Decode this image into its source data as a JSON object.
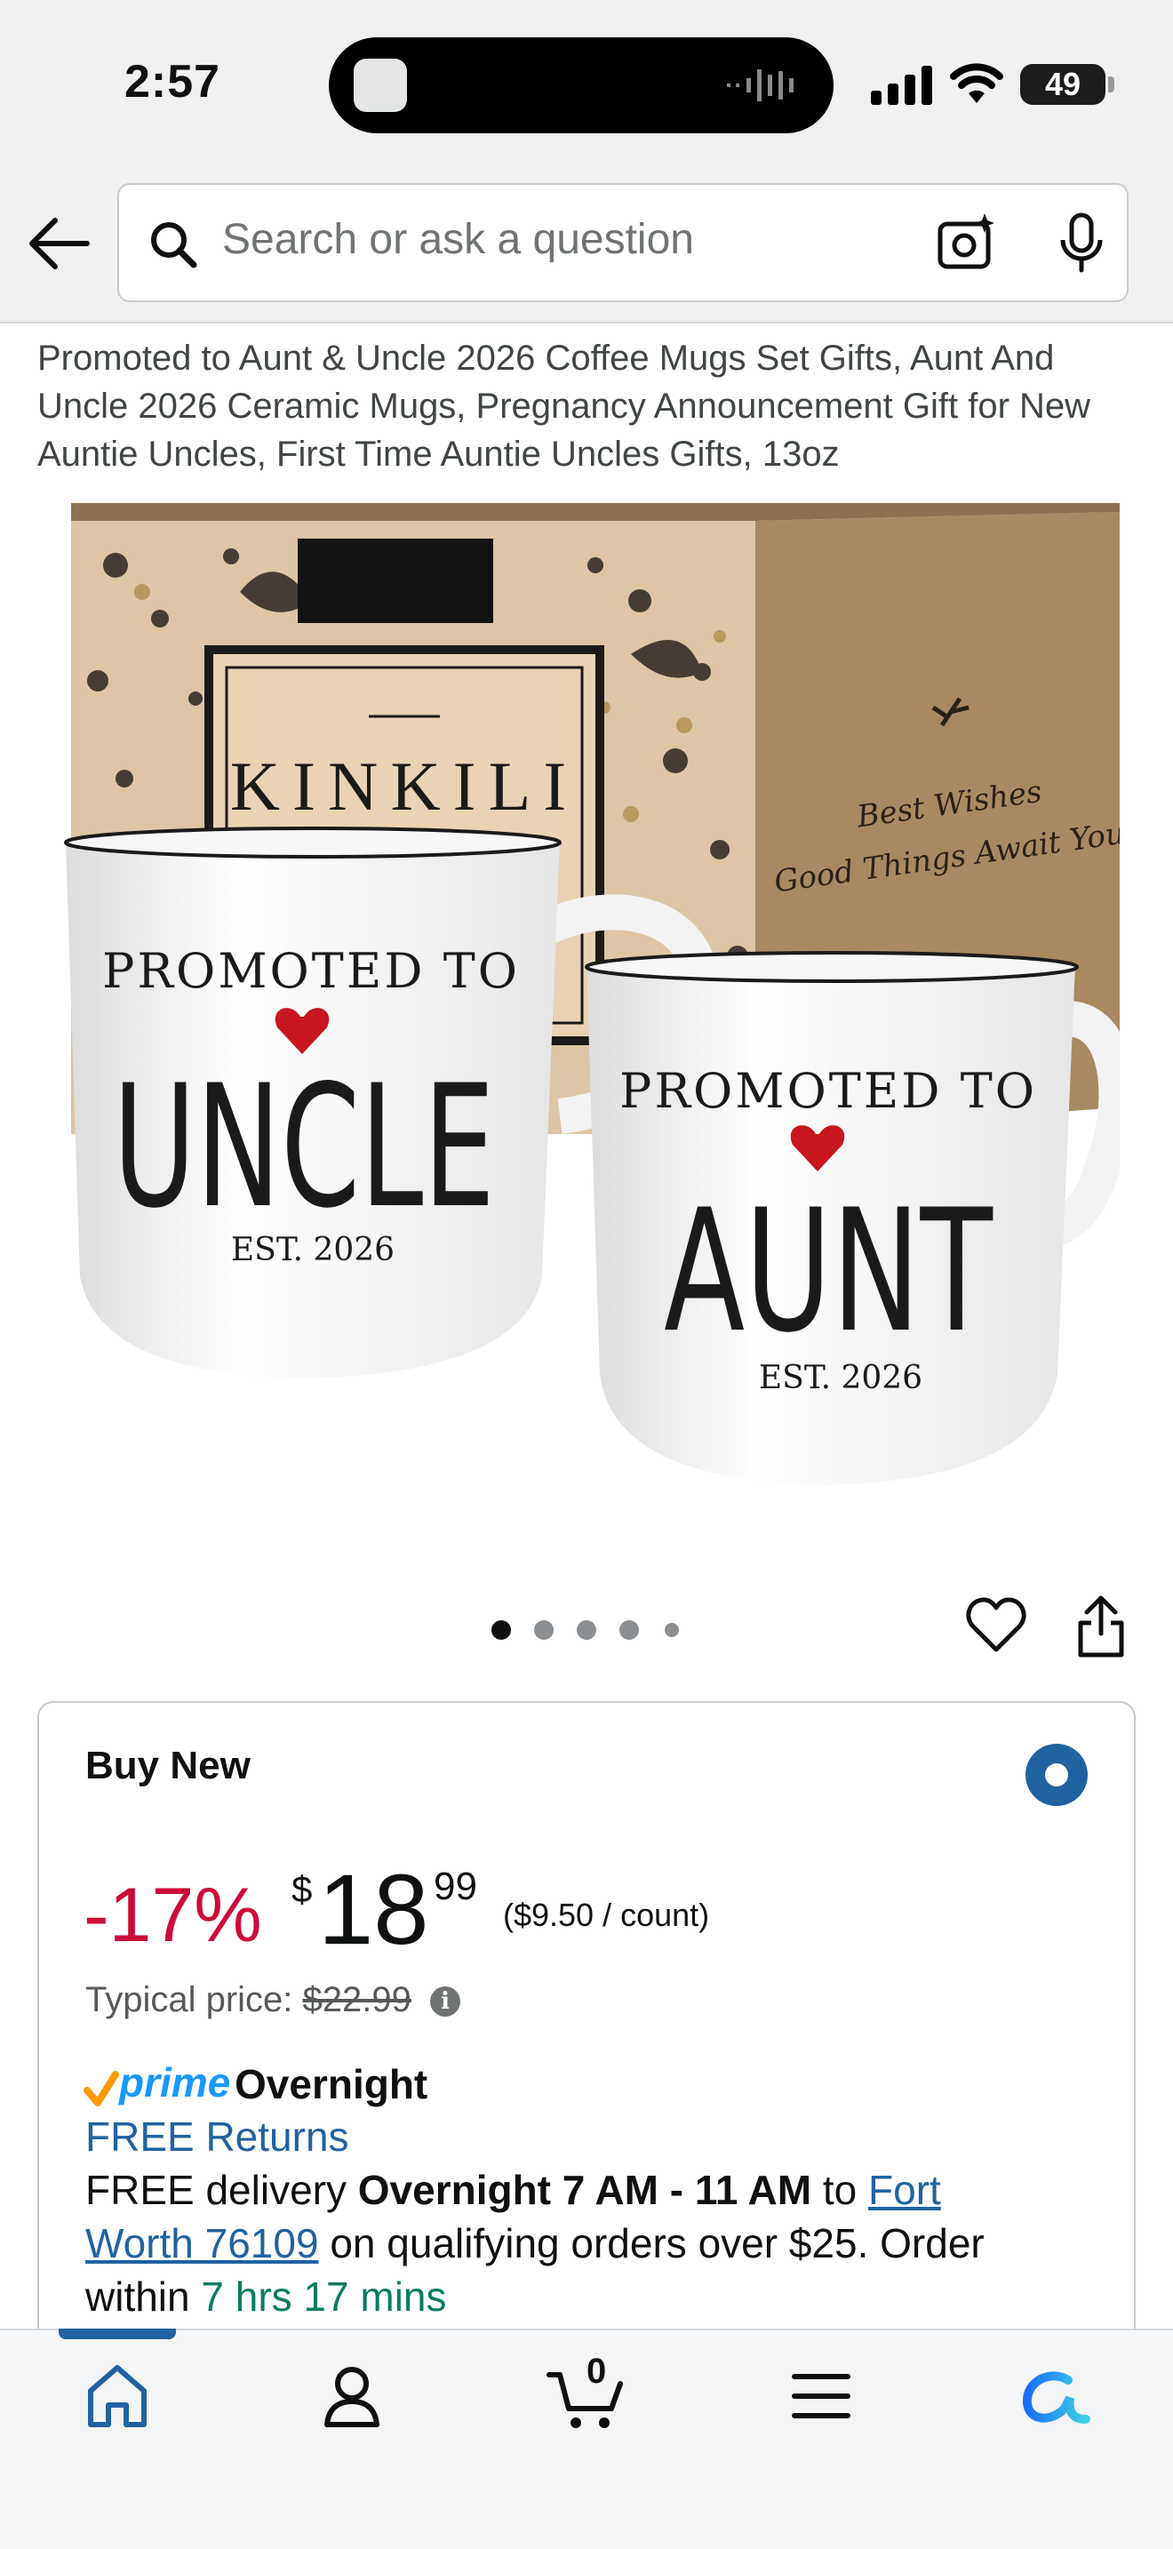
{
  "status_bar": {
    "time": "2:57",
    "battery": "49"
  },
  "search": {
    "placeholder": "Search or ask a question"
  },
  "product": {
    "title": "Promoted to Aunt & Uncle 2026 Coffee Mugs Set Gifts, Aunt And Uncle 2026 Ceramic Mugs, Pregnancy Announcement Gift for New Auntie Uncles, First Time Auntie Uncles Gifts, 13oz",
    "image": {
      "box_brand": "KINKILI",
      "box_text_line1": "Best Wishes",
      "box_text_line2": "Good Things Await You",
      "mug_left": {
        "top": "PROMOTED TO",
        "main": "UNCLE",
        "est": "EST. 2026"
      },
      "mug_right": {
        "top": "PROMOTED TO",
        "main": "AUNT",
        "est": "EST. 2026"
      }
    },
    "carousel": {
      "count": 5,
      "active": 0
    }
  },
  "buy_box": {
    "heading": "Buy New",
    "discount": "-17%",
    "currency": "$",
    "price_whole": "18",
    "price_fraction": "99",
    "unit_price": "($9.50 / count)",
    "typical_label": "Typical price:",
    "typical_price": "$22.99",
    "prime_word": "prime",
    "prime_speed": "Overnight",
    "free_returns": "FREE Returns",
    "delivery": {
      "prefix": "FREE delivery ",
      "window": "Overnight 7 AM - 11 AM",
      "to": " to ",
      "location_part1": "Fort",
      "location_part2": "Worth 76109",
      "suffix": " on qualifying orders over $25. Order",
      "within": "within ",
      "countdown": "7 hrs 17 mins"
    }
  },
  "nav": {
    "cart_count": "0"
  },
  "colors": {
    "accent_blue": "#2162a1",
    "deal_red": "#cc0c39",
    "prime_blue": "#1a98ff",
    "countdown_green": "#067d62"
  }
}
